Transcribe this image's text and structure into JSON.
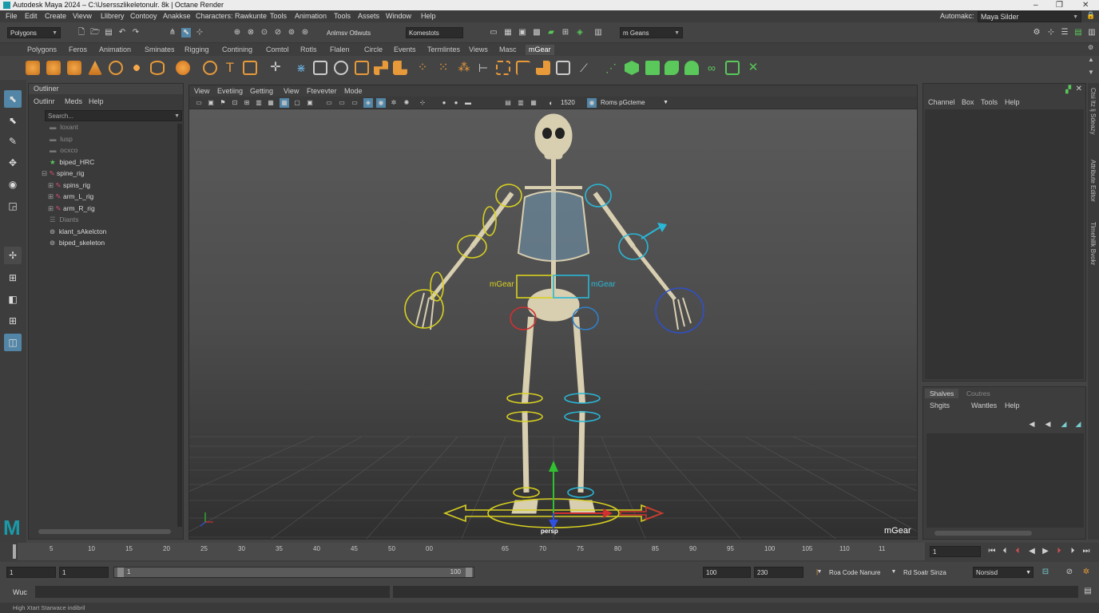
{
  "titlebar": {
    "title": "Autodesk Maya 2024 – C:\\Usersszlikeletonulr. 8k | Octane Render",
    "minimize": "–",
    "restore": "❐",
    "close": "✕"
  },
  "menubar": {
    "items": [
      "File",
      "Edit",
      "Create",
      "Vievw",
      "Llibrery",
      "Contooy",
      "Anakkse",
      "Characters:",
      "Rawkunte",
      "Tools",
      "Animation",
      "Tools",
      "Assets",
      "Window",
      "Help"
    ],
    "workspace_label": "Automakc:",
    "workspace_value": "Maya Silder"
  },
  "statusline": {
    "mode": "Polygons",
    "field1": "Anlmsv Otlwuts",
    "field2": "Komestots",
    "renderer": "m Geans"
  },
  "shelf_tabs": [
    "Polygons",
    "Feros",
    "Animation",
    "Sminates",
    "Rigging",
    "Contining",
    "Comtol",
    "Rotls",
    "Flalen",
    "Circle",
    "Events",
    "Termlintes",
    "Views",
    "Masc",
    "mGear"
  ],
  "shelf_active": "mGear",
  "outliner": {
    "title": "Outliner",
    "menu": [
      "Outlinr",
      "Meds",
      "Help"
    ],
    "search_placeholder": "Search...",
    "items": [
      {
        "label": "loxant",
        "dim": true
      },
      {
        "label": "lusp",
        "dim": true
      },
      {
        "label": "ocxco",
        "dim": true
      },
      {
        "label": "biped_HRC",
        "dim": false
      },
      {
        "label": "spine_rig",
        "dim": false
      },
      {
        "label": "spins_rig",
        "dim": false
      },
      {
        "label": "arm_L_rig",
        "dim": false
      },
      {
        "label": "arm_R_rig",
        "dim": false
      },
      {
        "label": "Diants",
        "dim": true
      },
      {
        "label": "klant_sAkelcton",
        "dim": false
      },
      {
        "label": "biped_skeleton",
        "dim": false
      }
    ]
  },
  "viewport": {
    "menu": [
      "View",
      "Evetiing",
      "Getting",
      "View",
      "Ftevevter",
      "Mode"
    ],
    "frame_value": "1520",
    "camera_dropdown": "Roms pGcteme",
    "camera_label": "persp",
    "brand": "mGear",
    "label_left": "mGear",
    "label_right": "mGear"
  },
  "channelbox": {
    "menu": [
      "Channel",
      "Box",
      "Tools",
      "Help"
    ]
  },
  "layers": {
    "tabs": [
      "Shalves",
      "Coutres"
    ],
    "menu": [
      "Shgits",
      "Wantles",
      "Help"
    ]
  },
  "side_tabs": [
    "Ctsi ltz lj Sdeazy",
    "Attribute Editor",
    "Tlmehillk Bvokr"
  ],
  "timeline": {
    "ticks": [
      "5",
      "10",
      "15",
      "20",
      "25",
      "30",
      "35",
      "40",
      "45",
      "50",
      "00",
      "65",
      "70",
      "75",
      "80",
      "85",
      "90",
      "95",
      "100",
      "105",
      "110",
      "11"
    ],
    "current_frame": "1"
  },
  "range": {
    "start": "1",
    "start2": "1",
    "slider_start": "1",
    "slider_end": "100",
    "end": "100",
    "end2": "230",
    "anim_layer": "Roa Code Nanure",
    "char_set": "Rd Soatr Sinza",
    "fps": "Norsisd"
  },
  "cmdline": {
    "lang": "Wuc"
  },
  "helpline": {
    "text": "High Xtart Starwace indibril"
  },
  "colors": {
    "accent": "#5285a6",
    "yellow": "#d8d020",
    "cyan": "#2ab8d8",
    "red": "#d03030",
    "blue": "#3050c8"
  }
}
